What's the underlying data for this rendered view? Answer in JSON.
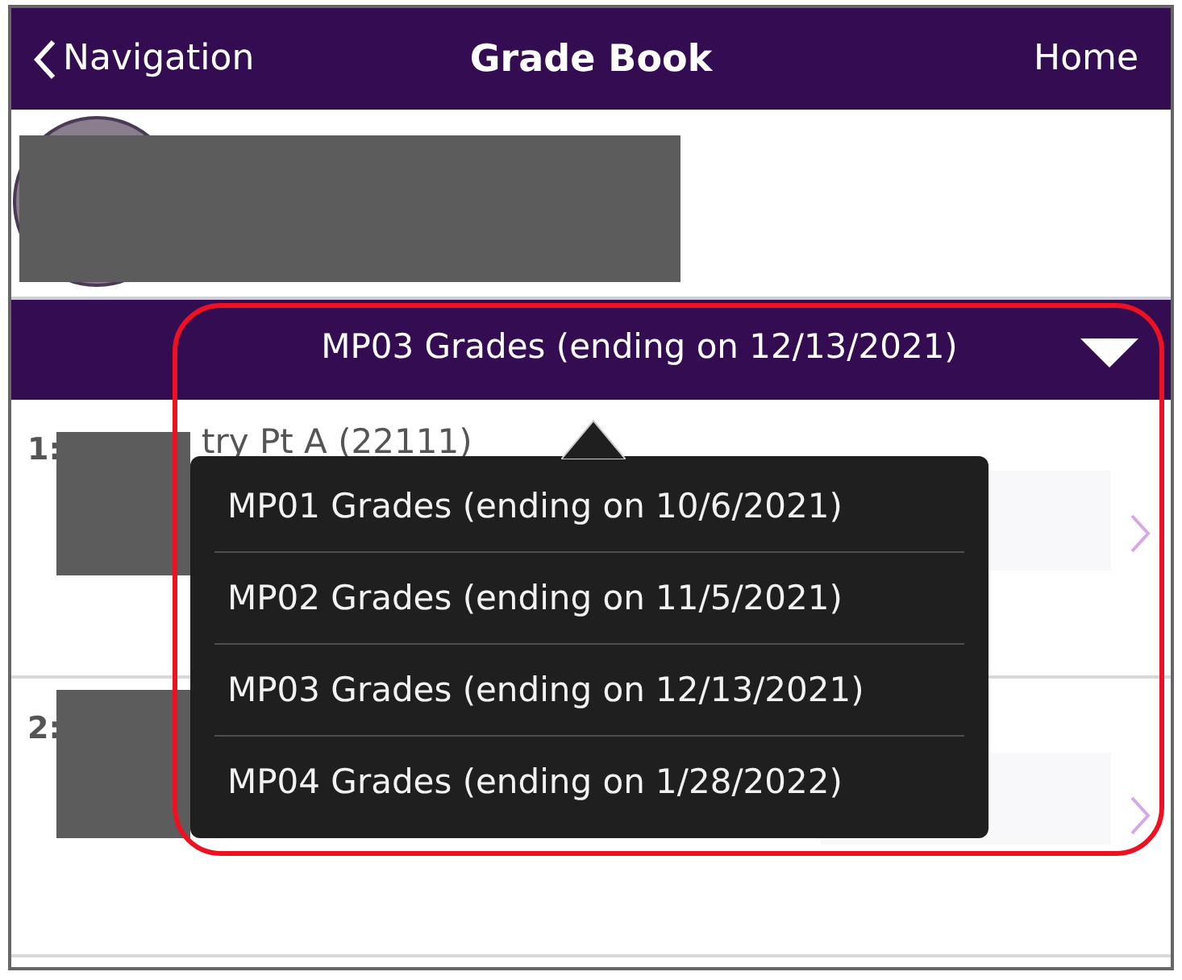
{
  "header": {
    "back_label": "Navigation",
    "title": "Grade Book",
    "home_label": "Home"
  },
  "selector": {
    "label": "MP03 Grades (ending on 12/13/2021)"
  },
  "courses": [
    {
      "index": "1:",
      "name": "try Pt A (22111)"
    },
    {
      "index": "2:"
    }
  ],
  "popover": {
    "items": [
      {
        "label": "MP01 Grades (ending on 10/6/2021)"
      },
      {
        "label": "MP02 Grades (ending on 11/5/2021)"
      },
      {
        "label": "MP03 Grades (ending on 12/13/2021)"
      },
      {
        "label": "MP04 Grades (ending on 1/28/2022)"
      }
    ]
  }
}
